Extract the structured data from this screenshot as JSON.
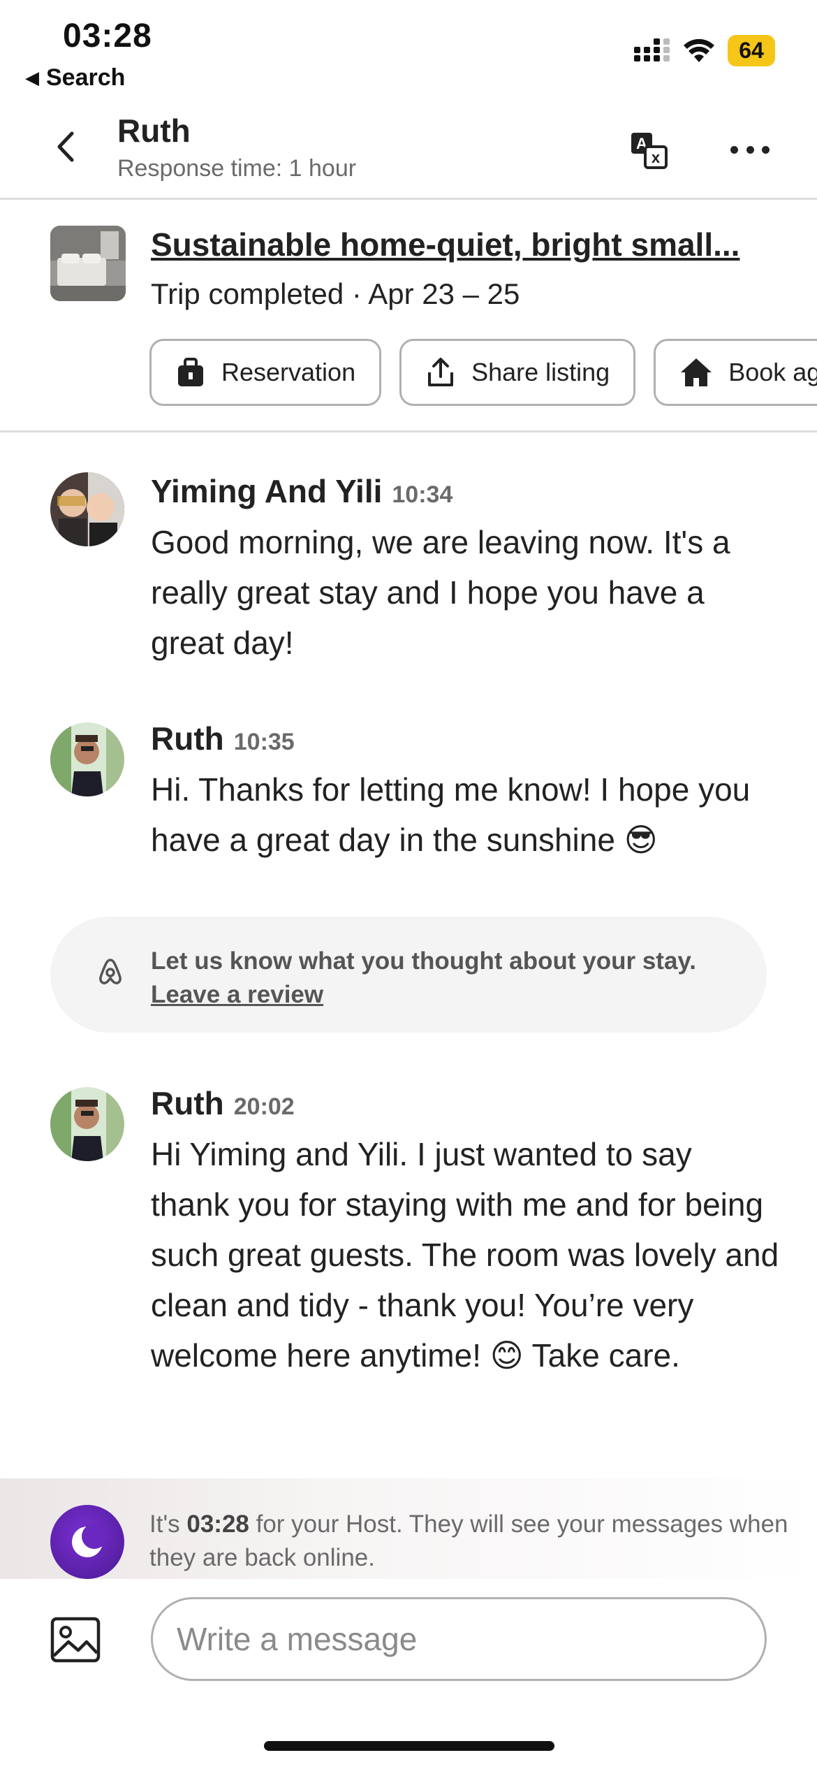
{
  "status_bar": {
    "time": "03:28",
    "back_label": "Search",
    "battery": "64"
  },
  "header": {
    "name": "Ruth",
    "response_time": "Response time: 1 hour"
  },
  "listing": {
    "title": "Sustainable home-quiet, bright small...",
    "trip_status": "Trip completed · Apr 23 – 25",
    "actions": [
      {
        "label": "Reservation",
        "icon": "bag-icon"
      },
      {
        "label": "Share listing",
        "icon": "share-icon"
      },
      {
        "label": "Book again",
        "icon": "home-icon"
      }
    ]
  },
  "messages": [
    {
      "author": "Yiming And Yili",
      "time": "10:34",
      "text": "Good morning, we are leaving now. It's a really great stay and I hope you have a great day!"
    },
    {
      "author": "Ruth",
      "time": "10:35",
      "text": "Hi.  Thanks for letting me know!  I hope you have a great day in the sunshine 😎"
    },
    {
      "author": "Ruth",
      "time": "20:02",
      "text": "Hi Yiming and Yili.  I just wanted to say thank you for staying with me and for being such great guests.  The room was lovely and clean and tidy - thank you! You’re very welcome here anytime! 😊 Take care."
    }
  ],
  "review_prompt": {
    "text": "Let us know what you thought about your stay.",
    "link": "Leave a review"
  },
  "host_time": {
    "prefix": "It's ",
    "time": "03:28",
    "suffix": " for your Host. They will see your messages when they are back online."
  },
  "composer": {
    "placeholder": "Write a message"
  }
}
